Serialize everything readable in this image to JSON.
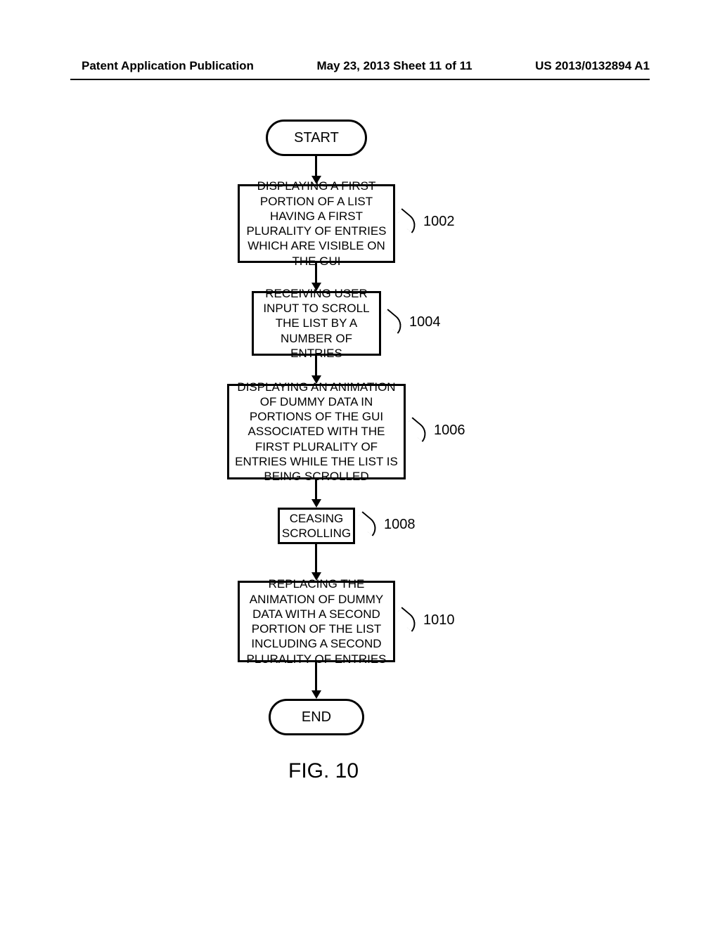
{
  "header": {
    "left": "Patent Application Publication",
    "center": "May 23, 2013  Sheet 11 of 11",
    "right": "US 2013/0132894 A1"
  },
  "flow": {
    "start": "START",
    "step1": "DISPLAYING A FIRST PORTION OF A LIST HAVING A FIRST PLURALITY OF ENTRIES WHICH ARE VISIBLE ON THE GUI",
    "step2": "RECEIVING USER INPUT TO SCROLL THE LIST BY A NUMBER OF ENTRIES",
    "step3": "DISPLAYING AN ANIMATION OF DUMMY DATA IN PORTIONS OF THE GUI ASSOCIATED WITH THE FIRST PLURALITY OF ENTRIES WHILE THE LIST IS BEING SCROLLED",
    "step4": "CEASING SCROLLING",
    "step5": "REPLACING THE ANIMATION OF DUMMY DATA WITH A SECOND PORTION OF THE LIST INCLUDING A SECOND PLURALITY OF ENTRIES",
    "end": "END"
  },
  "refs": {
    "r1": "1002",
    "r2": "1004",
    "r3": "1006",
    "r4": "1008",
    "r5": "1010"
  },
  "figure_label": "FIG. 10"
}
